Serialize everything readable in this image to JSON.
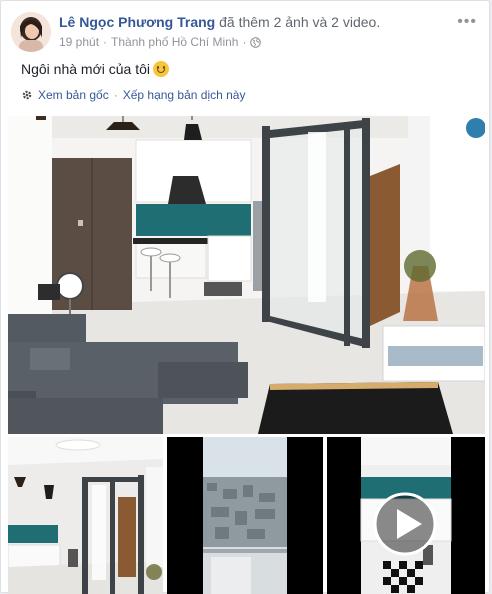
{
  "post": {
    "author": "Lê Ngọc Phương Trang",
    "action": "đã thêm 2 ảnh và 2 video.",
    "time": "19 phút",
    "location": "Thành phố Hồ Chí Minh",
    "text": "Ngôi nhà mới của tôi",
    "text_emoji": "smiling-face-emoji",
    "see_original": "Xem bản gốc",
    "rate_translation": "Xếp hạng bản dịch này",
    "more_icon": "more-options-icon"
  },
  "colors": {
    "link": "#365899",
    "muted": "#90949c"
  },
  "media": [
    {
      "type": "photo",
      "name": "living-room-photo"
    },
    {
      "type": "photo",
      "name": "glass-partition-photo"
    },
    {
      "type": "video",
      "name": "city-view-video"
    },
    {
      "type": "video",
      "name": "kitchen-video",
      "play_icon": "play-icon"
    }
  ]
}
